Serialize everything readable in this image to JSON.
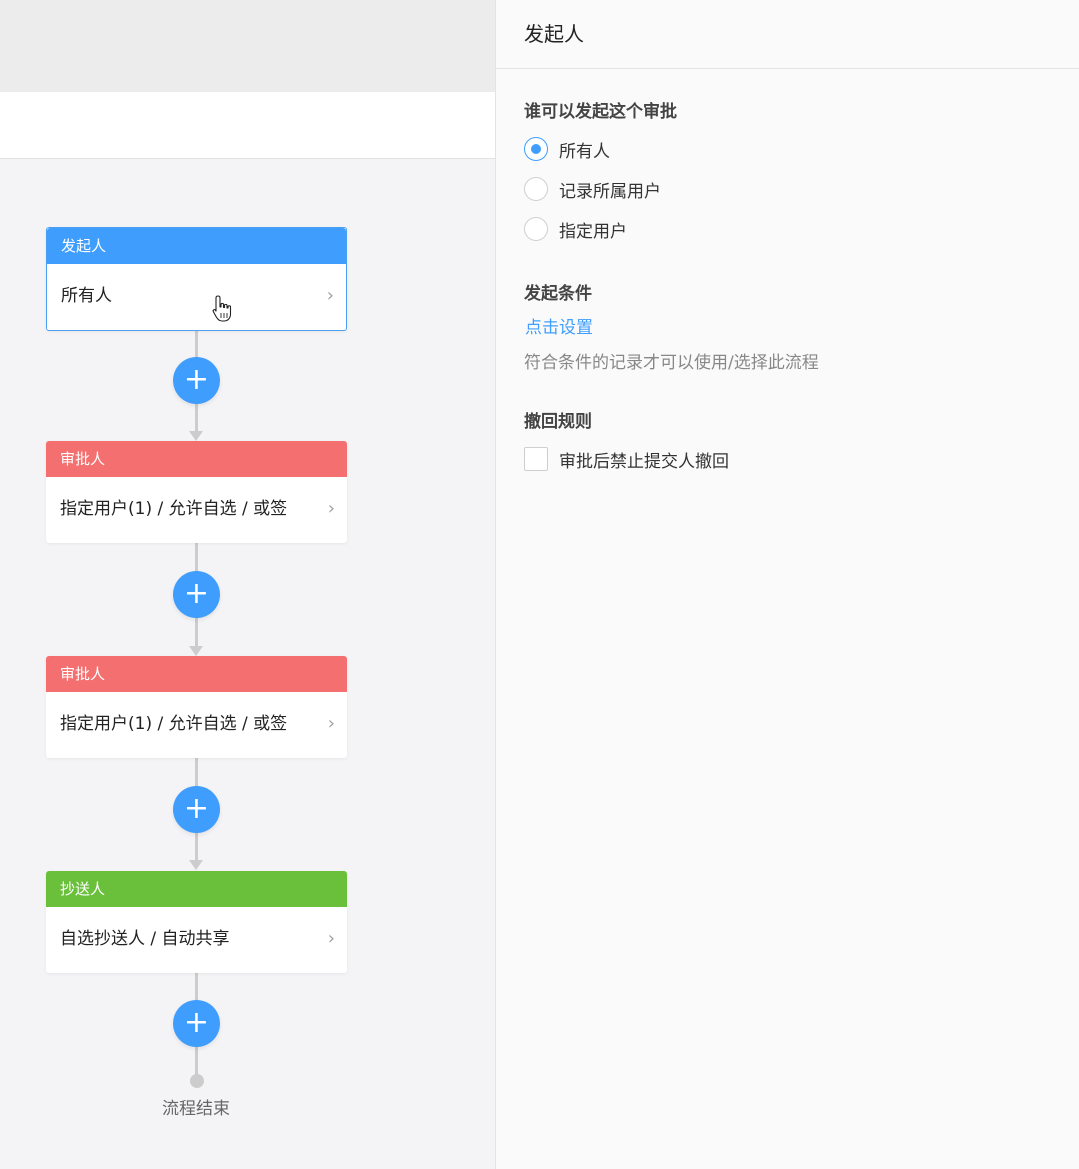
{
  "flow": {
    "nodes": [
      {
        "head": "发起人",
        "body": "所有人",
        "color": "#3f9efd",
        "chevron": "chevron-right-icon"
      },
      {
        "head": "审批人",
        "body": "指定用户(1) / 允许自选 / 或签",
        "color": "#f47070",
        "chevron": "chevron-right-icon"
      },
      {
        "head": "审批人",
        "body": "指定用户(1) / 允许自选 / 或签",
        "color": "#f47070",
        "chevron": "chevron-right-icon"
      },
      {
        "head": "抄送人",
        "body": "自选抄送人 / 自动共享",
        "color": "#6ac03b",
        "chevron": "chevron-right-icon"
      }
    ],
    "add_icon": "+",
    "chevron_glyph": "›",
    "end_label": "流程结束"
  },
  "panel": {
    "title": "发起人",
    "who_title": "谁可以发起这个审批",
    "who_options": [
      {
        "label": "所有人",
        "checked": true
      },
      {
        "label": "记录所属用户",
        "checked": false
      },
      {
        "label": "指定用户",
        "checked": false
      }
    ],
    "condition_title": "发起条件",
    "condition_link": "点击设置",
    "condition_hint": "符合条件的记录才可以使用/选择此流程",
    "withdraw_title": "撤回规则",
    "withdraw_option": "审批后禁止提交人撤回",
    "withdraw_checked": false
  },
  "colors": {
    "primary": "#3f9efd",
    "approver": "#f47070",
    "cc": "#6ac03b"
  }
}
